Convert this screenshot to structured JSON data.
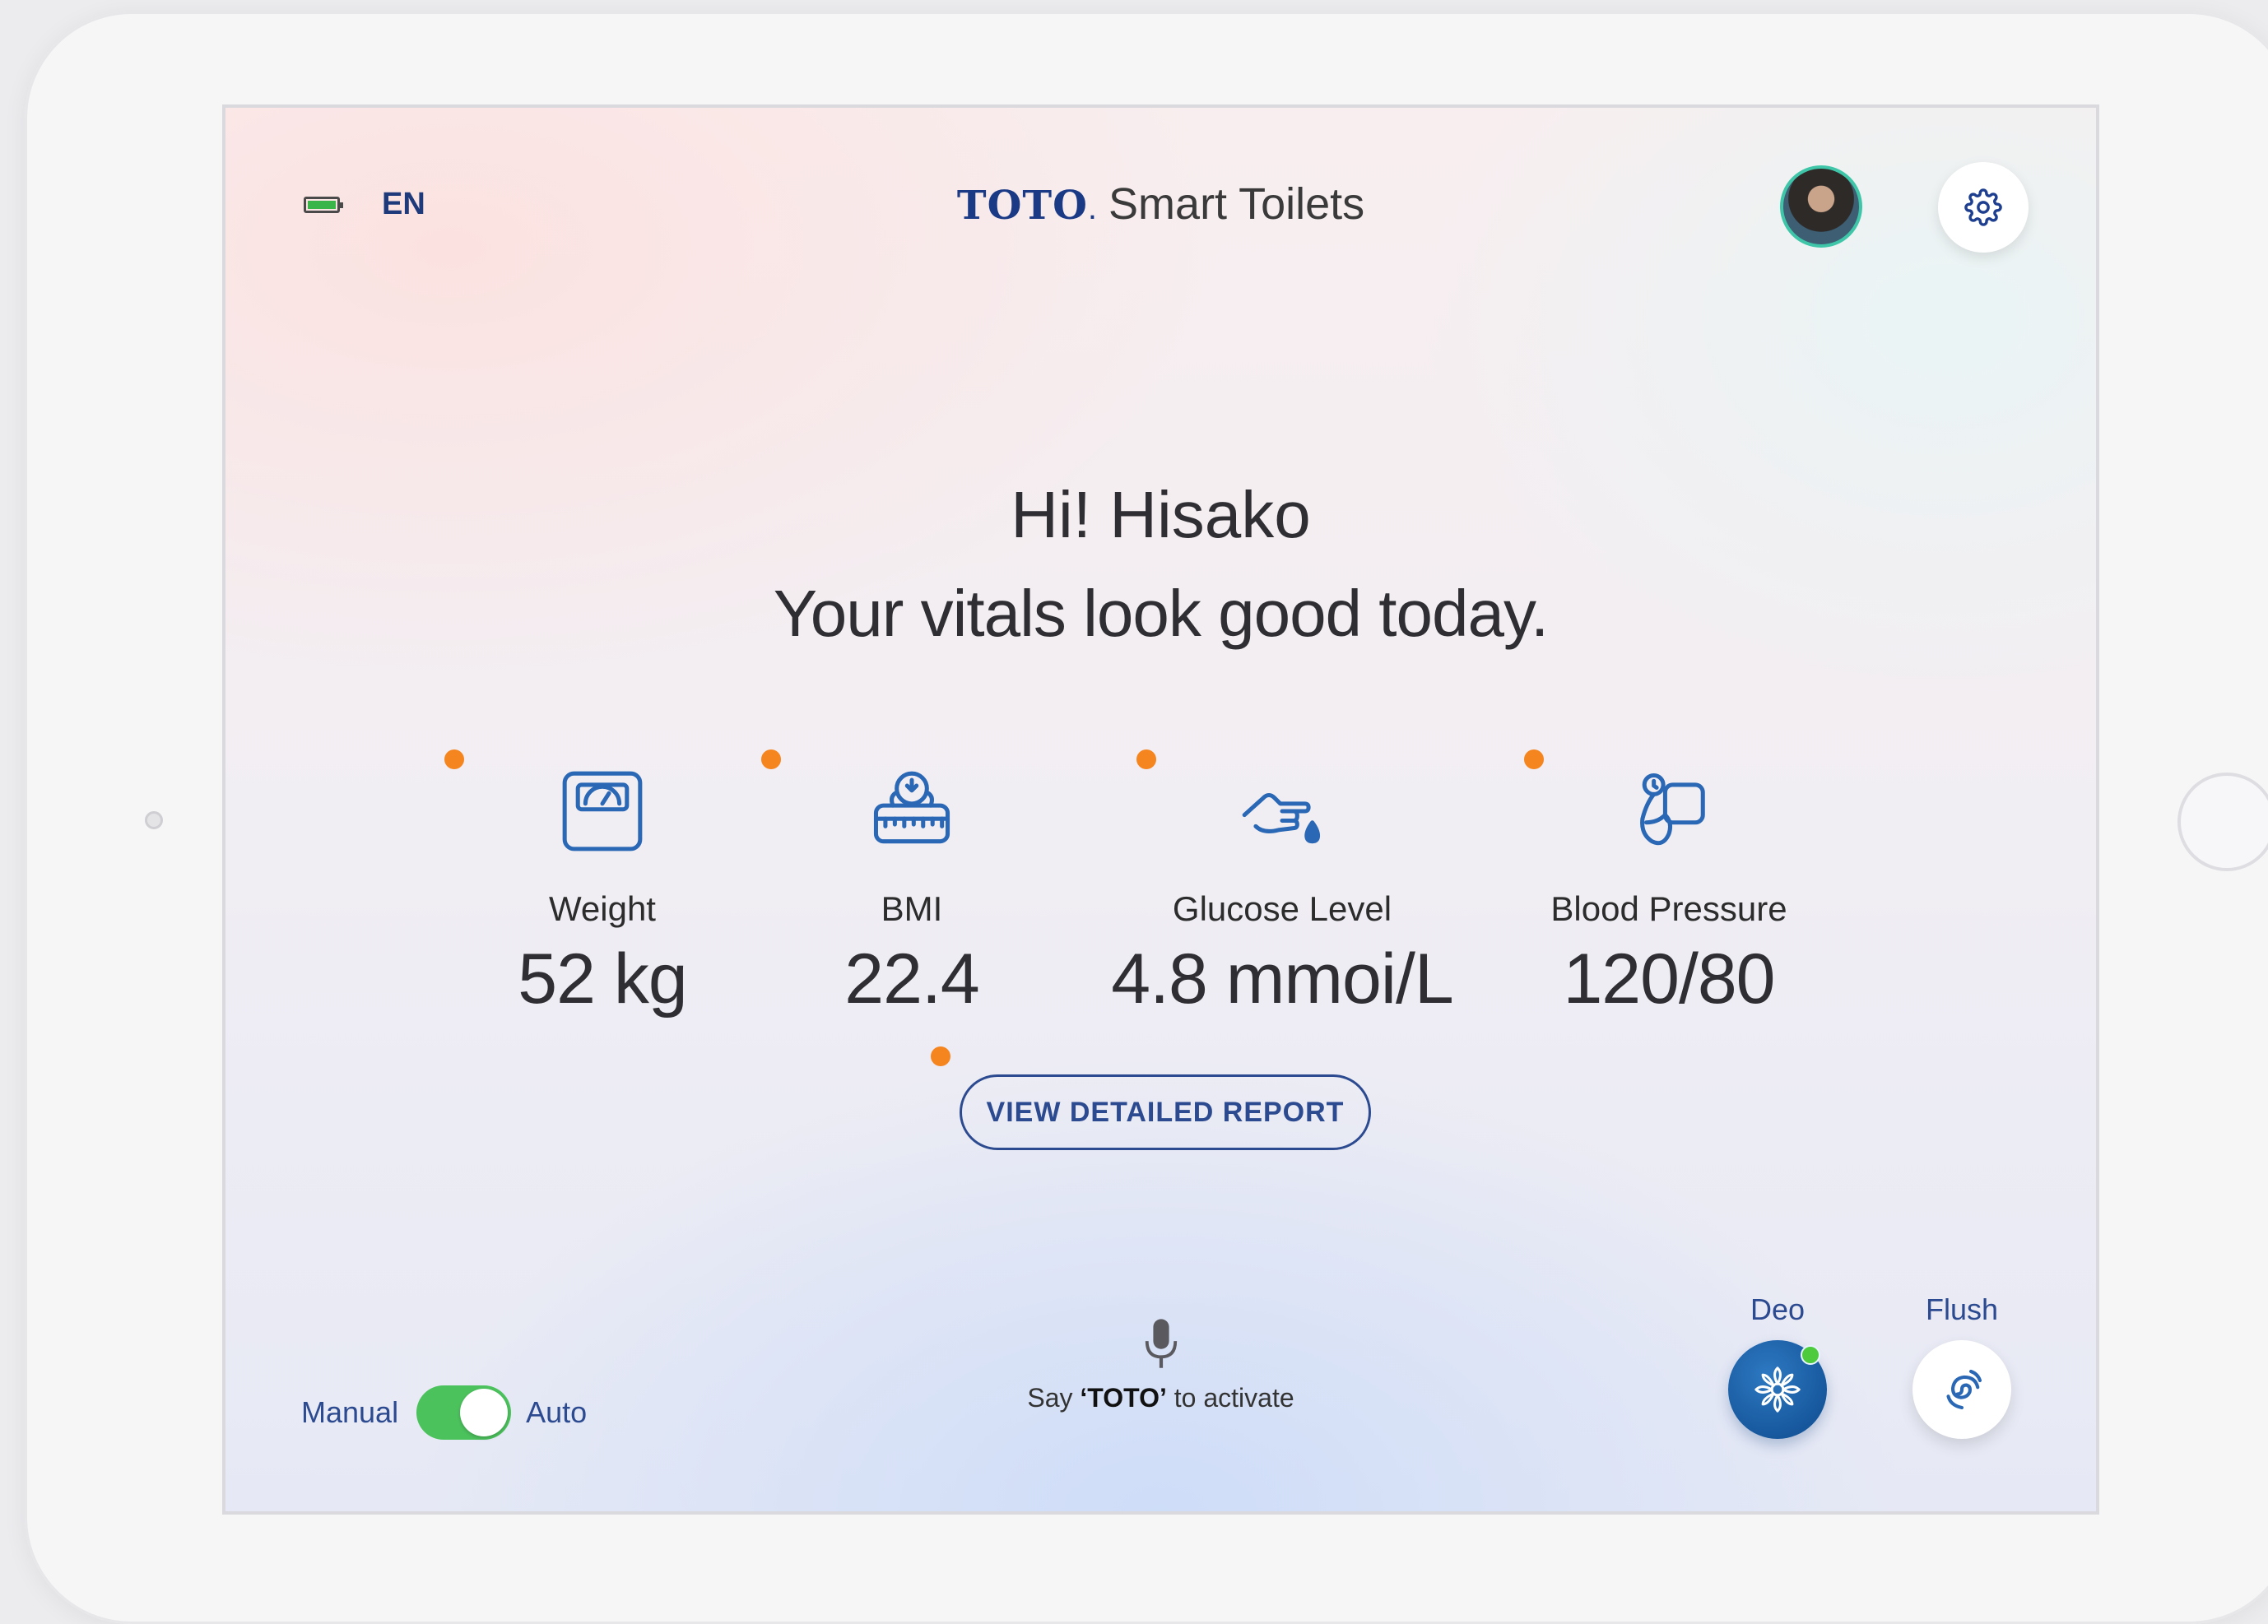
{
  "header": {
    "language": "EN",
    "brand_logo": "TOTO",
    "brand_dot": ".",
    "brand_name": "Smart Toilets"
  },
  "greeting": {
    "hello": "Hi! Hisako",
    "message": "Your vitals look good today."
  },
  "vitals": [
    {
      "label": "Weight",
      "value": "52 kg",
      "icon": "weight-scale-icon"
    },
    {
      "label": "BMI",
      "value": "22.4",
      "icon": "bmi-scale-icon"
    },
    {
      "label": "Glucose Level",
      "value": "4.8 mmoi/L",
      "icon": "glucose-drop-icon"
    },
    {
      "label": "Blood Pressure",
      "value": "120/80",
      "icon": "blood-pressure-icon"
    }
  ],
  "report_button": "VIEW DETAILED REPORT",
  "mode": {
    "manual_label": "Manual",
    "auto_label": "Auto",
    "selected": "Auto"
  },
  "voice": {
    "prefix": "Say ",
    "keyword": "‘TOTO’",
    "suffix": " to activate"
  },
  "actions": {
    "deo_label": "Deo",
    "flush_label": "Flush"
  },
  "colors": {
    "brand_blue": "#1b3a86",
    "accent_orange": "#f5851f",
    "toggle_green": "#4cc25d",
    "deo_blue": "#0e4a8e"
  }
}
